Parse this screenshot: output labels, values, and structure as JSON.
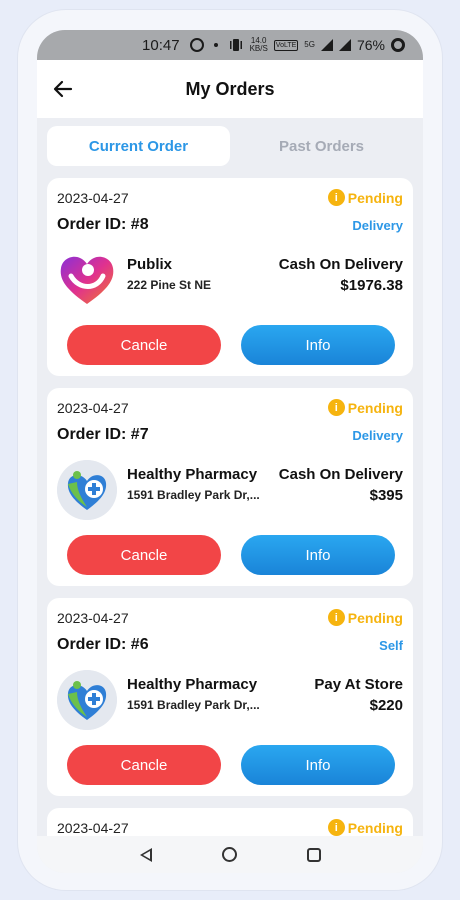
{
  "status_bar": {
    "time": "10:47",
    "net_speed_value": "14.0",
    "net_speed_unit": "KB/S",
    "volte_label": "VoLTE",
    "network_label": "5G",
    "battery": "76%"
  },
  "header": {
    "title": "My Orders"
  },
  "tabs": [
    {
      "label": "Current Order",
      "active": true
    },
    {
      "label": "Past Orders",
      "active": false
    }
  ],
  "orders": [
    {
      "date": "2023-04-27",
      "status": "Pending",
      "order_id": "Order ID: #8",
      "type": "Delivery",
      "store_name": "Publix",
      "address": "222 Pine St NE",
      "payment": "Cash On Delivery",
      "amount": "$1976.38",
      "cancel_label": "Cancle",
      "info_label": "Info",
      "logo": "heart-logo-icon"
    },
    {
      "date": "2023-04-27",
      "status": "Pending",
      "order_id": "Order ID: #7",
      "type": "Delivery",
      "store_name": "Healthy Pharmacy",
      "address": "1591 Bradley Park Dr,...",
      "payment": "Cash On Delivery",
      "amount": "$395",
      "cancel_label": "Cancle",
      "info_label": "Info",
      "logo": "pharmacy-heart-icon"
    },
    {
      "date": "2023-04-27",
      "status": "Pending",
      "order_id": "Order ID: #6",
      "type": "Self",
      "store_name": "Healthy Pharmacy",
      "address": "1591 Bradley Park Dr,...",
      "payment": "Pay At Store",
      "amount": "$220",
      "cancel_label": "Cancle",
      "info_label": "Info",
      "logo": "pharmacy-heart-icon"
    },
    {
      "date": "2023-04-27",
      "status": "Pending"
    }
  ],
  "colors": {
    "accent": "#2c97e6",
    "pending": "#f6b40f",
    "cancel": "#f24547",
    "info": "#1e90e0"
  }
}
